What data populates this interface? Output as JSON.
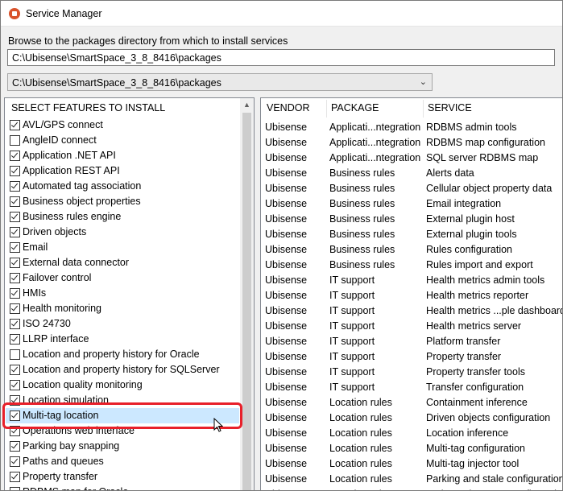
{
  "window": {
    "title": "Service Manager"
  },
  "browse": {
    "label": "Browse to the packages directory from which to install services",
    "path_value": "C:\\Ubisense\\SmartSpace_3_8_8416\\packages",
    "dropdown_value": "C:\\Ubisense\\SmartSpace_3_8_8416\\packages"
  },
  "features": {
    "header": "SELECT FEATURES TO INSTALL",
    "items": [
      {
        "label": "AVL/GPS connect",
        "checked": true
      },
      {
        "label": "AngleID connect",
        "checked": false
      },
      {
        "label": "Application .NET API",
        "checked": true
      },
      {
        "label": "Application REST API",
        "checked": true
      },
      {
        "label": "Automated tag association",
        "checked": true
      },
      {
        "label": "Business object properties",
        "checked": true
      },
      {
        "label": "Business rules engine",
        "checked": true
      },
      {
        "label": "Driven objects",
        "checked": true
      },
      {
        "label": "Email",
        "checked": true
      },
      {
        "label": "External data connector",
        "checked": true
      },
      {
        "label": "Failover control",
        "checked": true
      },
      {
        "label": "HMIs",
        "checked": true
      },
      {
        "label": "Health monitoring",
        "checked": true
      },
      {
        "label": "ISO 24730",
        "checked": true
      },
      {
        "label": "LLRP interface",
        "checked": true
      },
      {
        "label": "Location and property history for Oracle",
        "checked": false
      },
      {
        "label": "Location and property history for SQLServer",
        "checked": true
      },
      {
        "label": "Location quality monitoring",
        "checked": true
      },
      {
        "label": "Location simulation",
        "checked": true
      },
      {
        "label": "Multi-tag location",
        "checked": true,
        "selected": true
      },
      {
        "label": "Operations web interface",
        "checked": true
      },
      {
        "label": "Parking bay snapping",
        "checked": true
      },
      {
        "label": "Paths and queues",
        "checked": true
      },
      {
        "label": "Property transfer",
        "checked": true
      },
      {
        "label": "RDBMS map for Oracle",
        "checked": false
      }
    ]
  },
  "services": {
    "headers": {
      "vendor": "VENDOR",
      "package": "PACKAGE",
      "service": "SERVICE"
    },
    "rows": [
      [
        "Ubisense",
        "Applicati...ntegration",
        "RDBMS admin tools"
      ],
      [
        "Ubisense",
        "Applicati...ntegration",
        "RDBMS map configuration"
      ],
      [
        "Ubisense",
        "Applicati...ntegration",
        "SQL server RDBMS map"
      ],
      [
        "Ubisense",
        "Business rules",
        "Alerts data"
      ],
      [
        "Ubisense",
        "Business rules",
        "Cellular object property data"
      ],
      [
        "Ubisense",
        "Business rules",
        "Email integration"
      ],
      [
        "Ubisense",
        "Business rules",
        "External plugin host"
      ],
      [
        "Ubisense",
        "Business rules",
        "External plugin tools"
      ],
      [
        "Ubisense",
        "Business rules",
        "Rules configuration"
      ],
      [
        "Ubisense",
        "Business rules",
        "Rules import and export"
      ],
      [
        "Ubisense",
        "IT support",
        "Health metrics admin tools"
      ],
      [
        "Ubisense",
        "IT support",
        "Health metrics reporter"
      ],
      [
        "Ubisense",
        "IT support",
        "Health metrics ...ple dashboards"
      ],
      [
        "Ubisense",
        "IT support",
        "Health metrics server"
      ],
      [
        "Ubisense",
        "IT support",
        "Platform transfer"
      ],
      [
        "Ubisense",
        "IT support",
        "Property transfer"
      ],
      [
        "Ubisense",
        "IT support",
        "Property transfer tools"
      ],
      [
        "Ubisense",
        "IT support",
        "Transfer configuration"
      ],
      [
        "Ubisense",
        "Location rules",
        "Containment inference"
      ],
      [
        "Ubisense",
        "Location rules",
        "Driven objects configuration"
      ],
      [
        "Ubisense",
        "Location rules",
        "Location inference"
      ],
      [
        "Ubisense",
        "Location rules",
        "Multi-tag configuration"
      ],
      [
        "Ubisense",
        "Location rules",
        "Multi-tag injector tool"
      ],
      [
        "Ubisense",
        "Location rules",
        "Parking and stale configuration"
      ],
      [
        "Ubisense",
        "Location rules",
        "Paths and queues configuration"
      ]
    ]
  },
  "colors": {
    "highlight": "#e8202a",
    "selection": "#cce8ff"
  }
}
